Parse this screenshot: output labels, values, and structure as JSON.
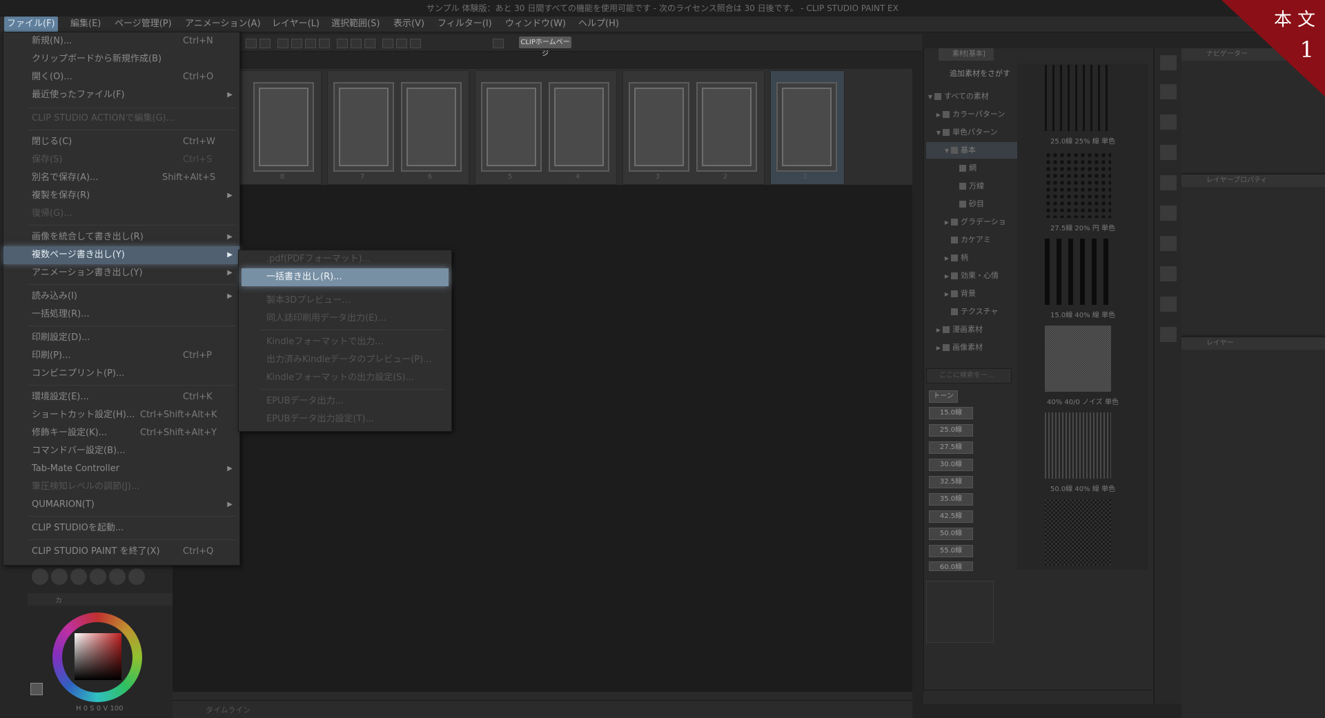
{
  "app": {
    "title": "サンプル 体験版：あと 30 日間すべての機能を使用可能です - 次のライセンス照合は 30 日後です。 - CLIP STUDIO PAINT EX"
  },
  "menubar": {
    "items": [
      "ファイル(F)",
      "編集(E)",
      "ページ管理(P)",
      "アニメーション(A)",
      "レイヤー(L)",
      "選択範囲(S)",
      "表示(V)",
      "フィルター(I)",
      "ウィンドウ(W)",
      "ヘルプ(H)"
    ]
  },
  "toolbar": {
    "clip_home_label": "CLIPホームページ"
  },
  "file_menu": {
    "items": [
      {
        "label": "新規(N)...",
        "shortcut": "Ctrl+N"
      },
      {
        "label": "クリップボードから新規作成(B)",
        "shortcut": ""
      },
      {
        "label": "開く(O)...",
        "shortcut": "Ctrl+O"
      },
      {
        "label": "最近使ったファイル(F)",
        "shortcut": ""
      },
      {
        "label": "CLIP STUDIO ACTIONで編集(G)...",
        "shortcut": ""
      },
      {
        "label": "閉じる(C)",
        "shortcut": "Ctrl+W"
      },
      {
        "label": "保存(S)",
        "shortcut": "Ctrl+S"
      },
      {
        "label": "別名で保存(A)...",
        "shortcut": "Shift+Alt+S"
      },
      {
        "label": "複製を保存(R)",
        "shortcut": ""
      },
      {
        "label": "復帰(G)...",
        "shortcut": ""
      },
      {
        "label": "画像を統合して書き出し(R)",
        "shortcut": ""
      },
      {
        "label": "複数ページ書き出し(Y)",
        "shortcut": ""
      },
      {
        "label": "アニメーション書き出し(Y)",
        "shortcut": ""
      },
      {
        "label": "読み込み(I)",
        "shortcut": ""
      },
      {
        "label": "一括処理(R)...",
        "shortcut": ""
      },
      {
        "label": "印刷設定(D)...",
        "shortcut": ""
      },
      {
        "label": "印刷(P)...",
        "shortcut": "Ctrl+P"
      },
      {
        "label": "コンビニプリント(P)...",
        "shortcut": ""
      },
      {
        "label": "環境設定(E)...",
        "shortcut": "Ctrl+K"
      },
      {
        "label": "ショートカット設定(H)...",
        "shortcut": "Ctrl+Shift+Alt+K"
      },
      {
        "label": "修飾キー設定(K)...",
        "shortcut": "Ctrl+Shift+Alt+Y"
      },
      {
        "label": "コマンドバー設定(B)...",
        "shortcut": ""
      },
      {
        "label": "Tab-Mate Controller",
        "shortcut": ""
      },
      {
        "label": "筆圧検知レベルの調節(J)...",
        "shortcut": ""
      },
      {
        "label": "QUMARION(T)",
        "shortcut": ""
      },
      {
        "label": "CLIP STUDIOを起動...",
        "shortcut": ""
      },
      {
        "label": "CLIP STUDIO PAINT を終了(X)",
        "shortcut": "Ctrl+Q"
      }
    ]
  },
  "submenu": {
    "items": [
      ".pdf(PDFフォーマット)...",
      "一括書き出し(R)...",
      "製本3Dプレビュー...",
      "同人誌印刷用データ出力(E)...",
      "Kindleフォーマットで出力...",
      "出力済みKindleデータのプレビュー(P)...",
      "Kindleフォーマットの出力設定(S)...",
      "EPUBデータ出力...",
      "EPUBデータ出力設定(T)..."
    ]
  },
  "pages": {
    "numbers": [
      "8",
      "7",
      "6",
      "5",
      "4",
      "3",
      "2",
      "1"
    ]
  },
  "material": {
    "tab": "素材[基本]",
    "search_button": "追加素材をさがす",
    "tree": [
      "すべての素材",
      "カラーパターン",
      "単色パターン",
      "基本",
      "網",
      "万線",
      "砂目",
      "グラデーショ",
      "カケアミ",
      "柄",
      "効果・心情",
      "背景",
      "テクスチャ",
      "漫画素材",
      "画像素材"
    ],
    "search_placeholder": "ここに検索を一…",
    "tags": [
      "トーン",
      "15.0線",
      "25.0線",
      "27.5線",
      "30.0線",
      "32.5線",
      "35.0線",
      "42.5線",
      "50.0線",
      "55.0線",
      "60.0線"
    ],
    "thumb_labels": [
      "25.0線 25% 線 単色",
      "27.5線 20% 円 単色",
      "15.0線 40% 線 単色",
      "40% 40/0 ノイズ 単色",
      "50.0線 40% 線 単色"
    ]
  },
  "panels": {
    "navigator": "ナビゲーター",
    "layer_property": "レイヤープロパティ",
    "layer": "レイヤー",
    "timeline": "タイムライン"
  },
  "color": {
    "tab": "カ",
    "h_label": "H",
    "h": "0",
    "s_label": "S",
    "s": "0",
    "v_label": "V",
    "v": "100"
  },
  "corner_badge": {
    "line1": "本文",
    "line2": "1",
    "color": "#8b0f16"
  }
}
